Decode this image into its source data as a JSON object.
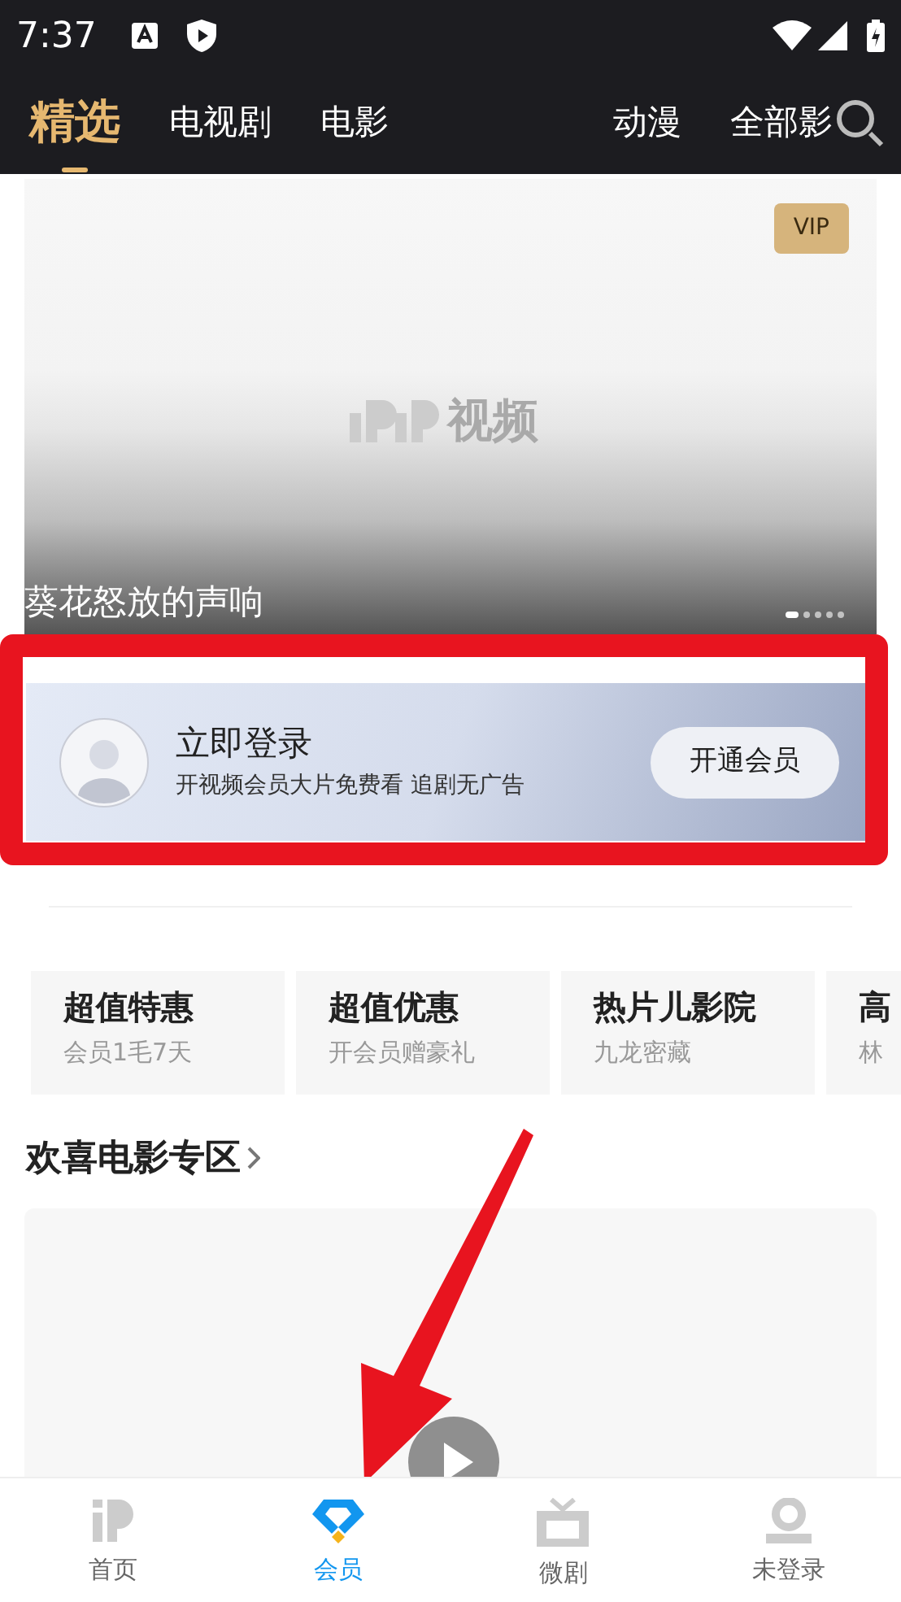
{
  "status_bar": {
    "time": "7:37"
  },
  "tabs": [
    {
      "label": "精选",
      "selected": true
    },
    {
      "label": "电视剧",
      "selected": false
    },
    {
      "label": "电影",
      "selected": false
    },
    {
      "label": "动漫",
      "selected": false
    },
    {
      "label": "全部影",
      "selected": false
    }
  ],
  "banner": {
    "badge": "VIP",
    "placeholder_text": "视频",
    "title": "葵花怒放的声响",
    "slides": [
      {
        "selected": true
      },
      {
        "selected": false
      },
      {
        "selected": false
      },
      {
        "selected": false
      },
      {
        "selected": false
      }
    ]
  },
  "login_card": {
    "title": "立即登录",
    "subtitle": "开视频会员大片免费看 追剧无广告",
    "button": "开通会员"
  },
  "promos": [
    {
      "title": "超值特惠",
      "subtitle": "会员1毛7天"
    },
    {
      "title": "超值优惠",
      "subtitle": "开会员赠豪礼"
    },
    {
      "title": "热片儿影院",
      "subtitle": "九龙密藏"
    },
    {
      "title": "高",
      "subtitle": "林"
    }
  ],
  "section": {
    "title": "欢喜电影专区"
  },
  "bottom_nav": [
    {
      "label": "首页",
      "kind": "home",
      "selected": false
    },
    {
      "label": "会员",
      "kind": "vip",
      "selected": true
    },
    {
      "label": "微剧",
      "kind": "tv",
      "selected": false
    },
    {
      "label": "未登录",
      "kind": "user",
      "selected": false
    }
  ]
}
